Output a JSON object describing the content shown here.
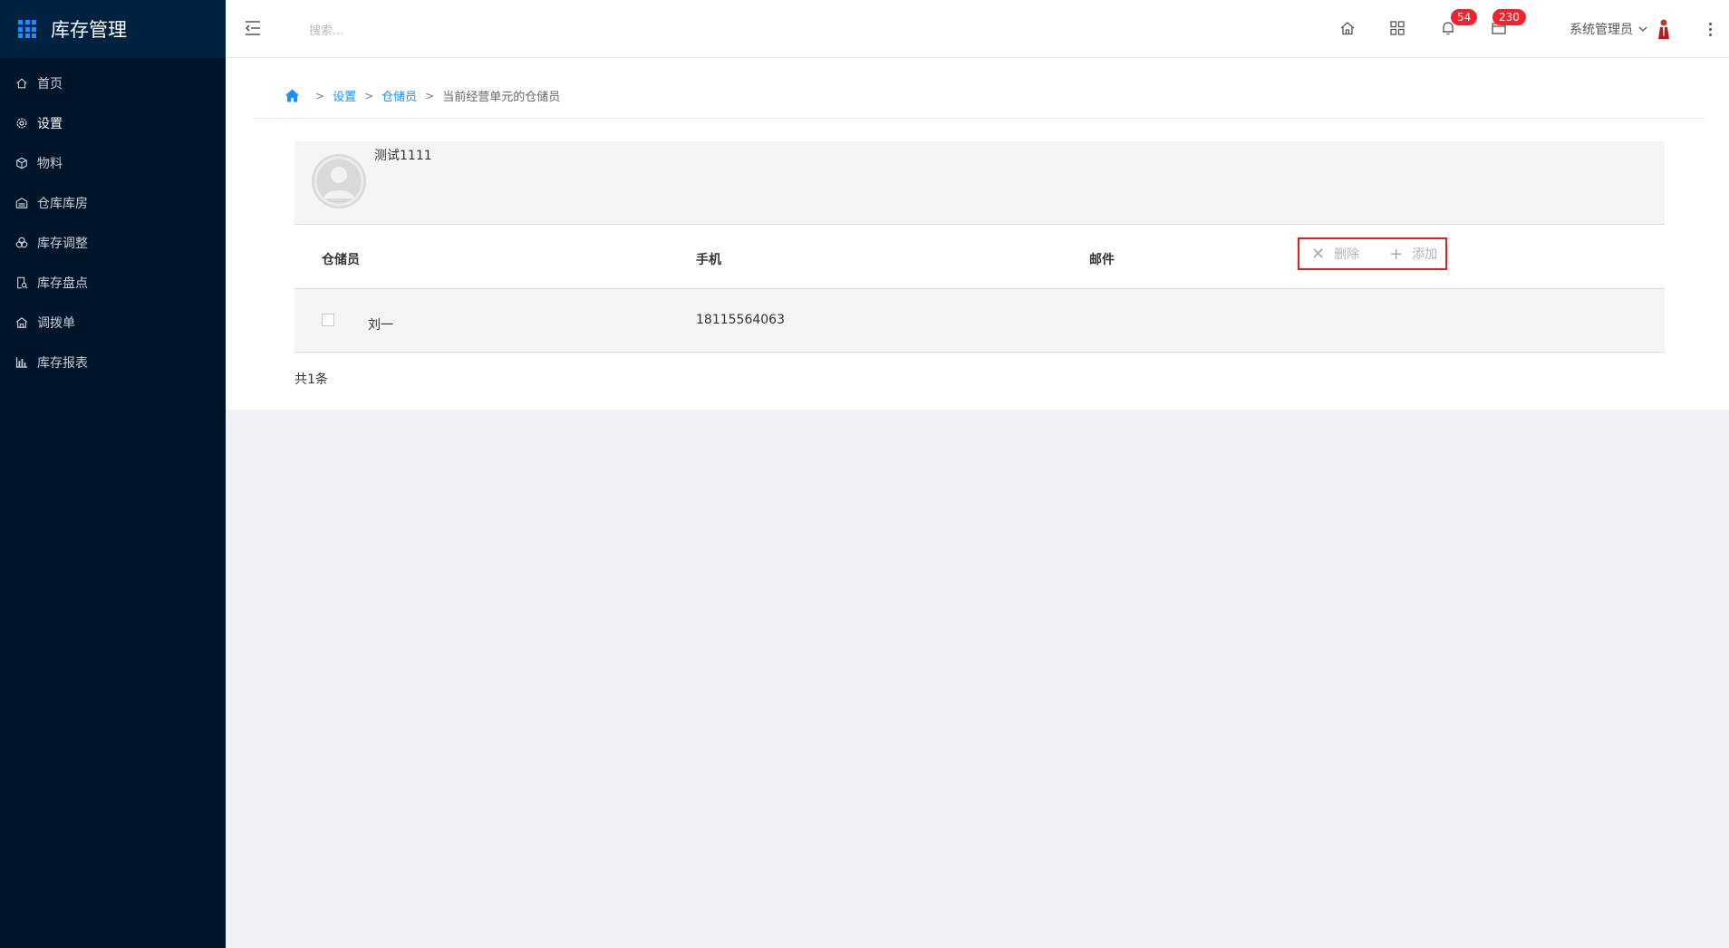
{
  "app": {
    "title": "库存管理"
  },
  "sidebar": {
    "items": [
      {
        "label": "首页",
        "icon": "home-icon",
        "active": false
      },
      {
        "label": "设置",
        "icon": "gear-icon",
        "active": true
      },
      {
        "label": "物料",
        "icon": "cube-icon",
        "active": false
      },
      {
        "label": "仓库库房",
        "icon": "warehouse-icon",
        "active": false
      },
      {
        "label": "库存调整",
        "icon": "adjust-icon",
        "active": false
      },
      {
        "label": "库存盘点",
        "icon": "inventory-check-icon",
        "active": false
      },
      {
        "label": "调拨单",
        "icon": "transfer-icon",
        "active": false
      },
      {
        "label": "库存报表",
        "icon": "bar-chart-icon",
        "active": false
      }
    ]
  },
  "header": {
    "search_placeholder": "搜索...",
    "notifications_badge": "54",
    "messages_badge": "230",
    "user_name": "系统管理员"
  },
  "breadcrumb": {
    "items": [
      "设置",
      "仓储员"
    ],
    "current": "当前经营单元的仓储员"
  },
  "card": {
    "name": "测试1111"
  },
  "table": {
    "columns": [
      "仓储员",
      "手机",
      "邮件"
    ],
    "actions": {
      "delete_label": "删除",
      "add_label": "添加"
    },
    "rows": [
      {
        "name": "刘一",
        "phone": "18115564063",
        "email": ""
      }
    ]
  },
  "footer": {
    "total": "共1条"
  },
  "colors": {
    "sidebar_bg": "#001529",
    "accent": "#1890ff",
    "badge": "#f5222d",
    "highlight_border": "#e02020"
  }
}
